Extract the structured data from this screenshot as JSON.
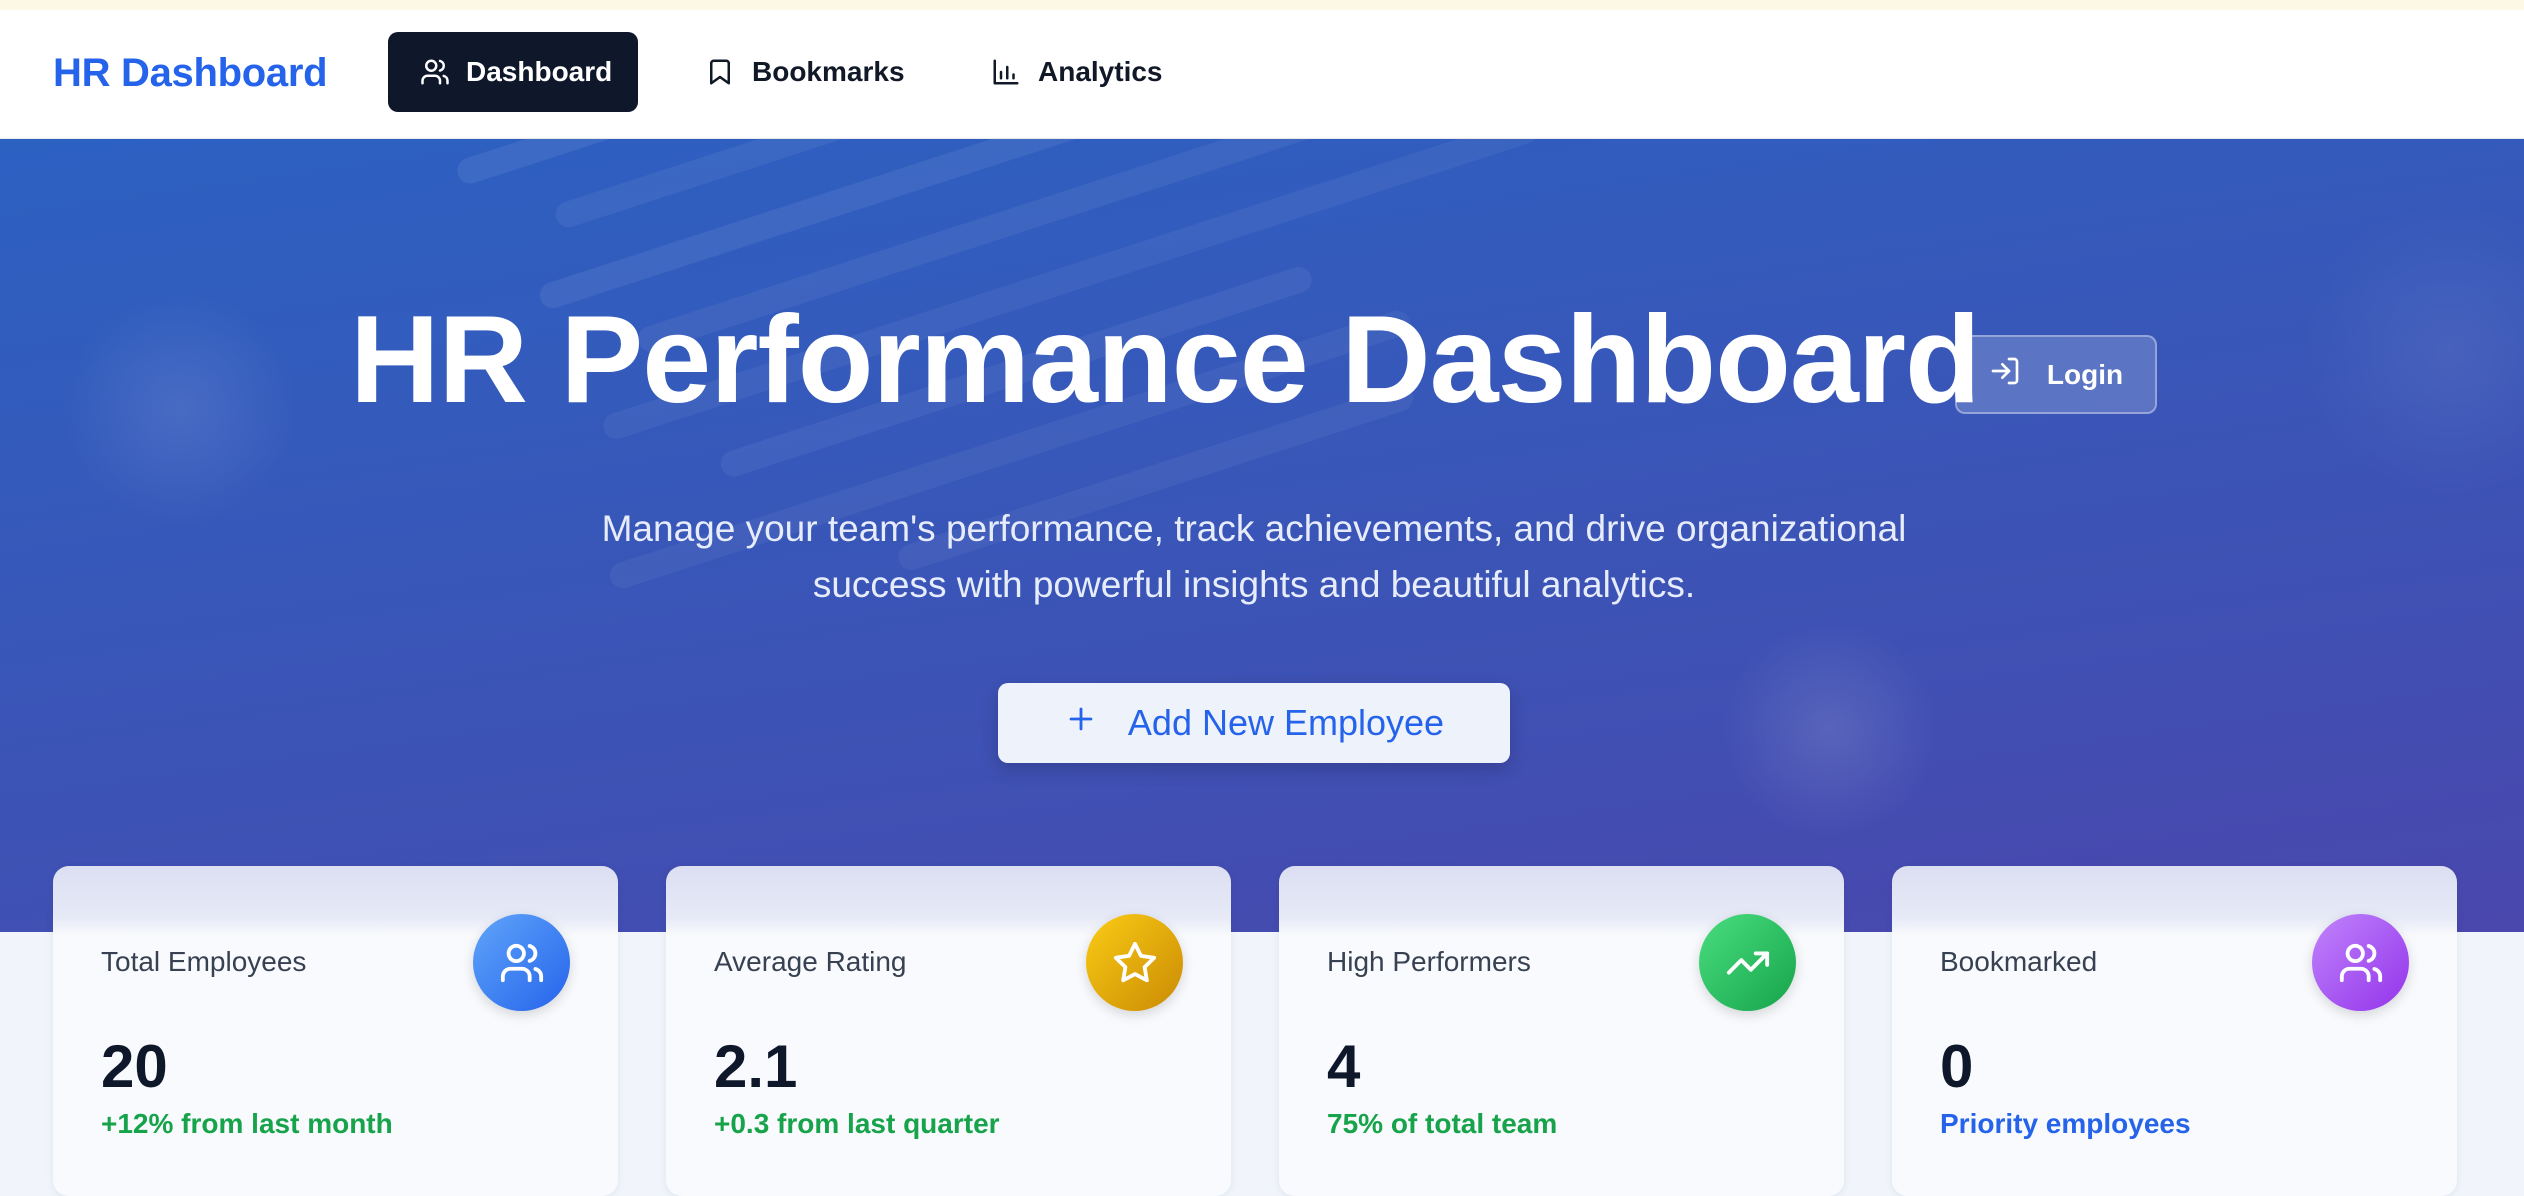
{
  "nav": {
    "brand": "HR Dashboard",
    "items": [
      {
        "label": "Dashboard",
        "icon": "users-icon",
        "active": true
      },
      {
        "label": "Bookmarks",
        "icon": "bookmark-icon",
        "active": false
      },
      {
        "label": "Analytics",
        "icon": "bar-chart-icon",
        "active": false
      }
    ]
  },
  "hero": {
    "title": "HR Performance Dashboard",
    "login_label": "Login",
    "subtitle_line1": "Manage your team's performance, track achievements, and drive organizational",
    "subtitle_line2": "success with powerful insights and beautiful analytics.",
    "add_button_label": "Add New Employee"
  },
  "stats": [
    {
      "label": "Total Employees",
      "value": "20",
      "sub": "+12% from last month",
      "icon": "users-icon",
      "color": "#3b82f6"
    },
    {
      "label": "Average Rating",
      "value": "2.1",
      "sub": "+0.3 from last quarter",
      "icon": "star-icon",
      "color": "#eab308"
    },
    {
      "label": "High Performers",
      "value": "4",
      "sub": "75% of total team",
      "icon": "trending-up-icon",
      "color": "#22c55e"
    },
    {
      "label": "Bookmarked",
      "value": "0",
      "sub": "Priority employees",
      "icon": "users-icon",
      "color": "#a855f7"
    }
  ],
  "colors": {
    "accent": "#2563eb",
    "nav_active_bg": "#0f172a",
    "positive": "#16a34a"
  }
}
